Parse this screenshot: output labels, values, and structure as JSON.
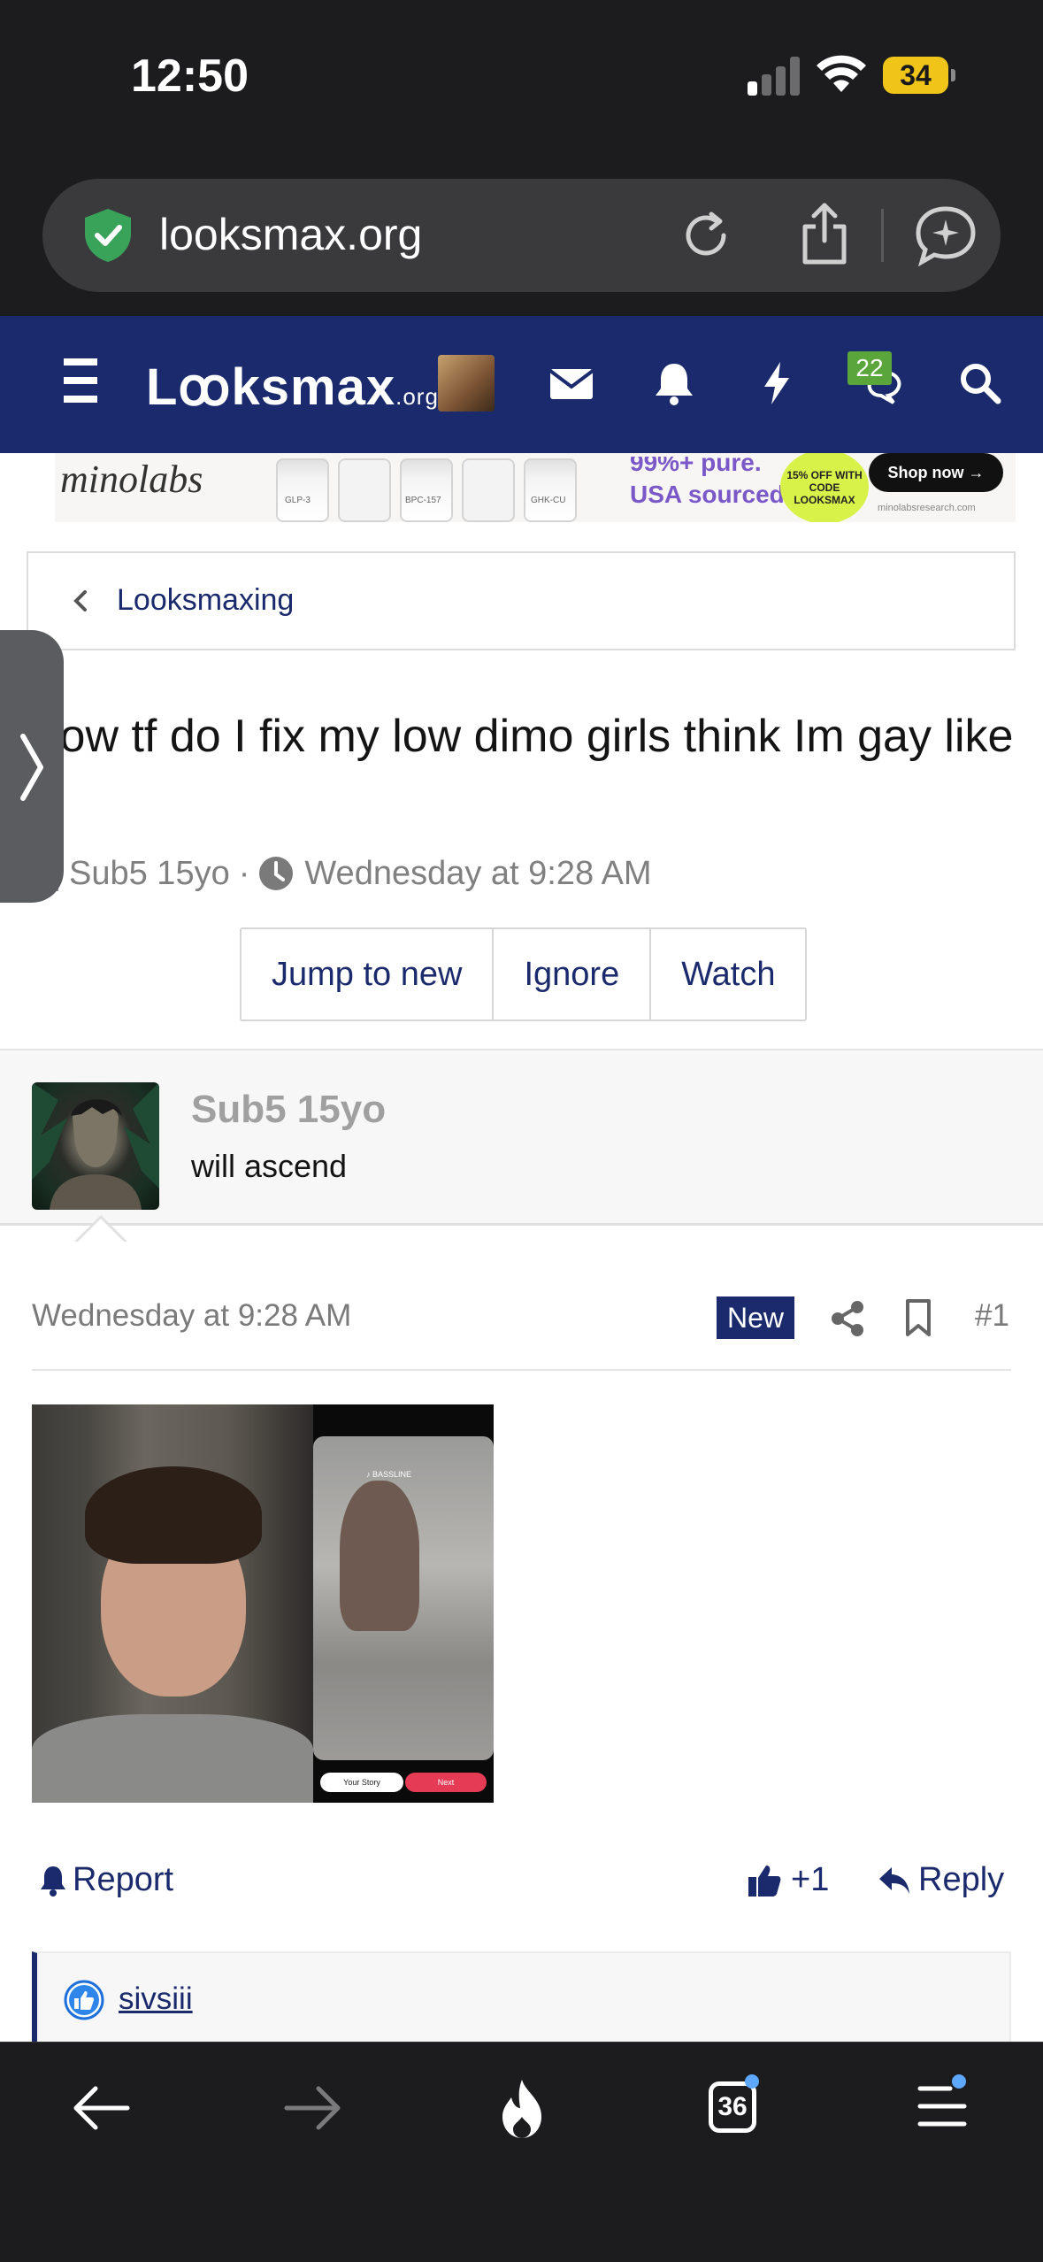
{
  "status": {
    "time": "12:50",
    "battery": "34"
  },
  "browser": {
    "url": "looksmax.org"
  },
  "navbar": {
    "brand_main": "Lꝏksmax",
    "brand_suffix": ".org",
    "alerts_badge": "22"
  },
  "banner": {
    "logo": "minolabs",
    "line1": "99%+ pure.",
    "line2": "USA sourced.",
    "promo": "15% OFF WITH CODE LOOKSMAX",
    "shop": "Shop now →",
    "site": "minolabsresearch.com",
    "vials": [
      "GLP-3",
      "BPC-157",
      "GHK-CU"
    ]
  },
  "breadcrumb": {
    "label": "Looksmaxing"
  },
  "thread": {
    "title": "How tf do I fix my low dimo girls think Im gay like tf",
    "author": "Sub5 15yo",
    "separator": "·",
    "date": "Wednesday at 9:28 AM"
  },
  "actions": {
    "jump": "Jump to new",
    "ignore": "Ignore",
    "watch": "Watch"
  },
  "post": {
    "username": "Sub5 15yo",
    "user_title": "will ascend",
    "date": "Wednesday at 9:28 AM",
    "new_label": "New",
    "number": "#1",
    "attachment_phone": {
      "label": "♪ BASSLINE",
      "story": "Your Story",
      "next": "Next"
    },
    "report": "Report",
    "likes_count": "+1",
    "reply": "Reply",
    "liked_by": "sivsiii"
  },
  "toolbar": {
    "tabs": "36"
  },
  "colors": {
    "brand": "#1a2a6c",
    "like_badge": "#5aa63a",
    "status_battery": "#f0c419"
  }
}
